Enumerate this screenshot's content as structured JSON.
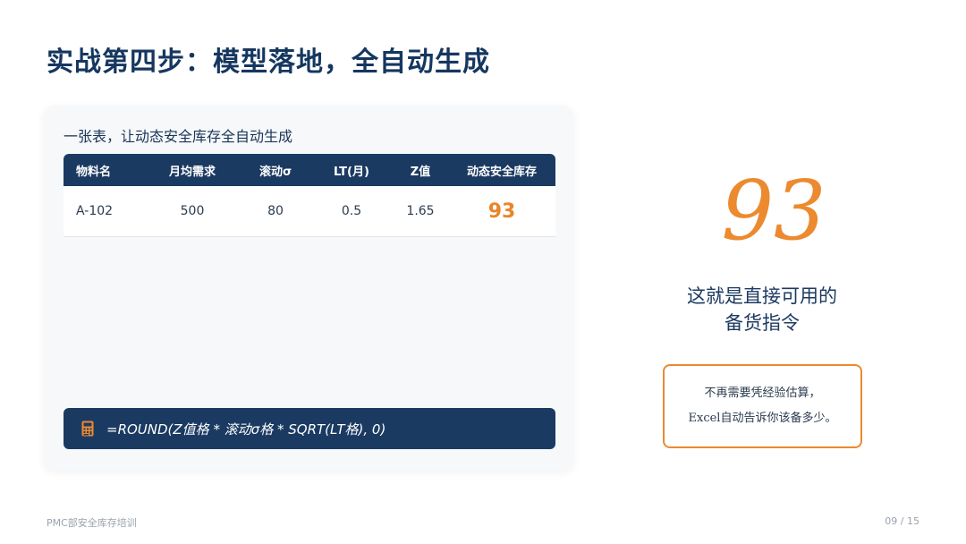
{
  "slide": {
    "title": "实战第四步：模型落地，全自动生成"
  },
  "card": {
    "subtitle": "一张表，让动态安全库存全自动生成",
    "table": {
      "headers": [
        "物料名",
        "月均需求",
        "滚动σ",
        "LT(月)",
        "Z值",
        "动态安全库存"
      ],
      "rows": [
        [
          "A-102",
          "500",
          "80",
          "0.5",
          "1.65",
          "93"
        ]
      ]
    },
    "formula": {
      "icon": "calculator-icon",
      "text": "=ROUND(Z值格 * 滚动σ格 * SQRT(LT格), 0)"
    }
  },
  "result": {
    "number": "93",
    "caption_line1": "这就是直接可用的",
    "caption_line2": "备货指令"
  },
  "note": {
    "line1": "不再需要凭经验估算，",
    "line2": "Excel自动告诉你该备多少。"
  },
  "footer": {
    "left": "PMC部安全库存培训",
    "right": "09 / 15"
  },
  "colors": {
    "navy": "#1b3a62",
    "accent": "#ec8a2f"
  }
}
